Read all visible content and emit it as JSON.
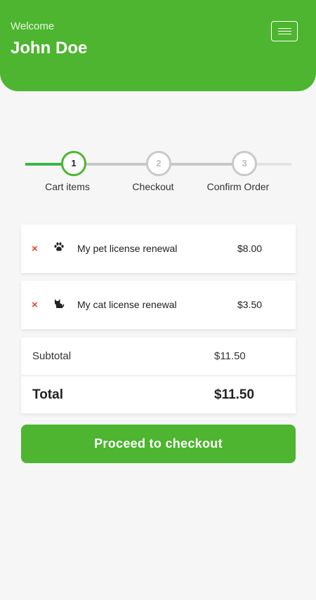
{
  "header": {
    "welcome": "Welcome",
    "username": "John Doe",
    "menu_icon": "hamburger-menu-icon"
  },
  "stepper": {
    "current_step": 1,
    "steps": [
      {
        "number": "1",
        "label": "Cart items",
        "state": "active"
      },
      {
        "number": "2",
        "label": "Checkout",
        "state": "pending"
      },
      {
        "number": "3",
        "label": "Confirm Order",
        "state": "pending"
      }
    ]
  },
  "cart": {
    "items": [
      {
        "remove": "×",
        "icon": "paw-icon",
        "name": "My pet license renewal",
        "price": "$8.00"
      },
      {
        "remove": "×",
        "icon": "cat-icon",
        "name": "My cat license renewal",
        "price": "$3.50"
      }
    ]
  },
  "summary": {
    "subtotal_label": "Subtotal",
    "subtotal_value": "$11.50",
    "total_label": "Total",
    "total_value": "$11.50"
  },
  "checkout_button": "Proceed to checkout",
  "colors": {
    "brand_green": "#4db52f",
    "remove_red": "#e0472b",
    "page_bg": "#f6f6f6"
  }
}
